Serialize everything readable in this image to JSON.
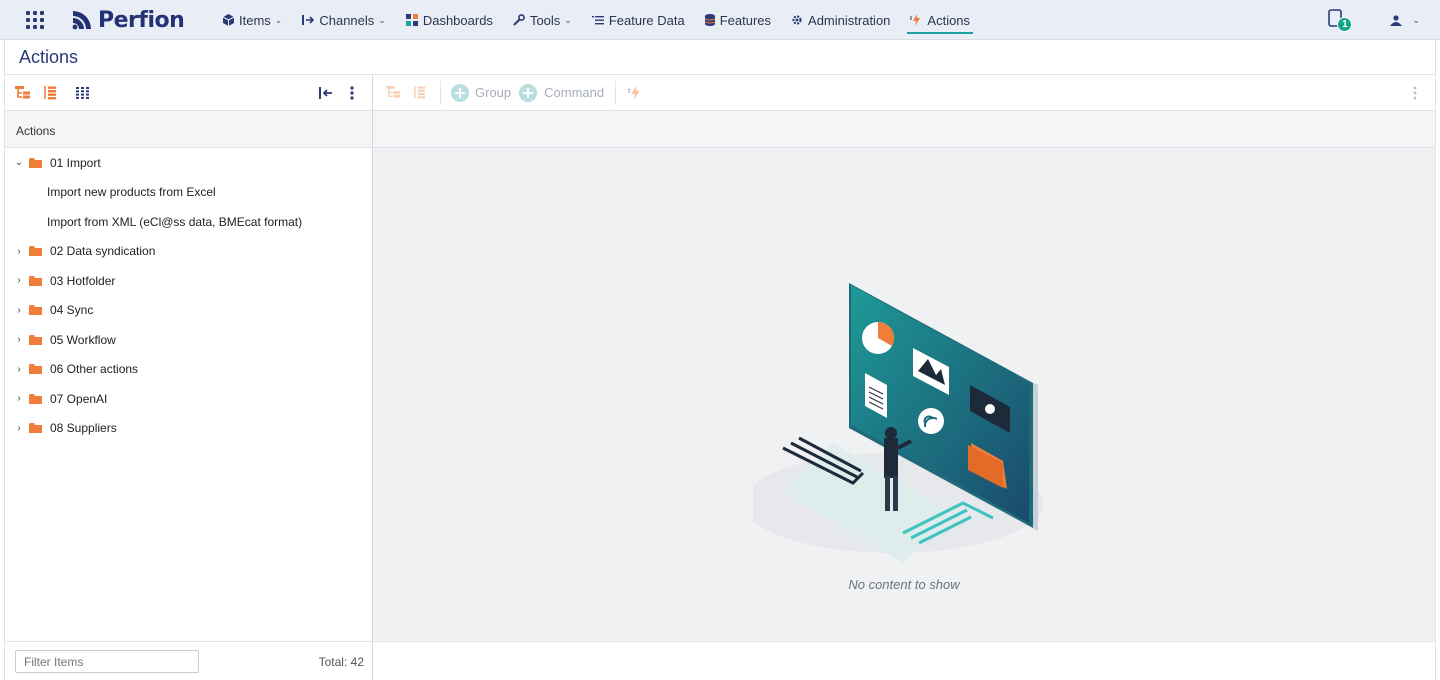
{
  "app": {
    "logo_text": "Perfion",
    "brand_color": "#223273",
    "accent_color": "#1aa3a3",
    "folder_color": "#f07e3a"
  },
  "nav": {
    "items": [
      {
        "label": "Items",
        "icon": "cube-icon",
        "dropdown": true
      },
      {
        "label": "Channels",
        "icon": "export-icon",
        "dropdown": true
      },
      {
        "label": "Dashboards",
        "icon": "dashboard-icon",
        "dropdown": false
      },
      {
        "label": "Tools",
        "icon": "wrench-icon",
        "dropdown": true
      },
      {
        "label": "Feature Data",
        "icon": "list-icon",
        "dropdown": false
      },
      {
        "label": "Features",
        "icon": "database-icon",
        "dropdown": false
      },
      {
        "label": "Administration",
        "icon": "gear-icon",
        "dropdown": false
      },
      {
        "label": "Actions",
        "icon": "lightning-icon",
        "dropdown": false,
        "active": true
      }
    ],
    "notification_count": "1"
  },
  "page": {
    "title": "Actions"
  },
  "left": {
    "header": "Actions",
    "tree": [
      {
        "label": "01 Import",
        "expanded": true,
        "children": [
          "Import new products from Excel",
          "Import from XML (eCl@ss data, BMEcat format)"
        ]
      },
      {
        "label": "02 Data syndication",
        "expanded": false
      },
      {
        "label": "03 Hotfolder",
        "expanded": false
      },
      {
        "label": "04 Sync",
        "expanded": false
      },
      {
        "label": "05 Workflow",
        "expanded": false
      },
      {
        "label": "06 Other actions",
        "expanded": false
      },
      {
        "label": "07 OpenAI",
        "expanded": false
      },
      {
        "label": "08 Suppliers",
        "expanded": false
      }
    ],
    "filter_placeholder": "Filter Items",
    "total": "Total: 42"
  },
  "right": {
    "toolbar": {
      "group_label": "Group",
      "command_label": "Command"
    },
    "empty_message": "No content to show"
  }
}
